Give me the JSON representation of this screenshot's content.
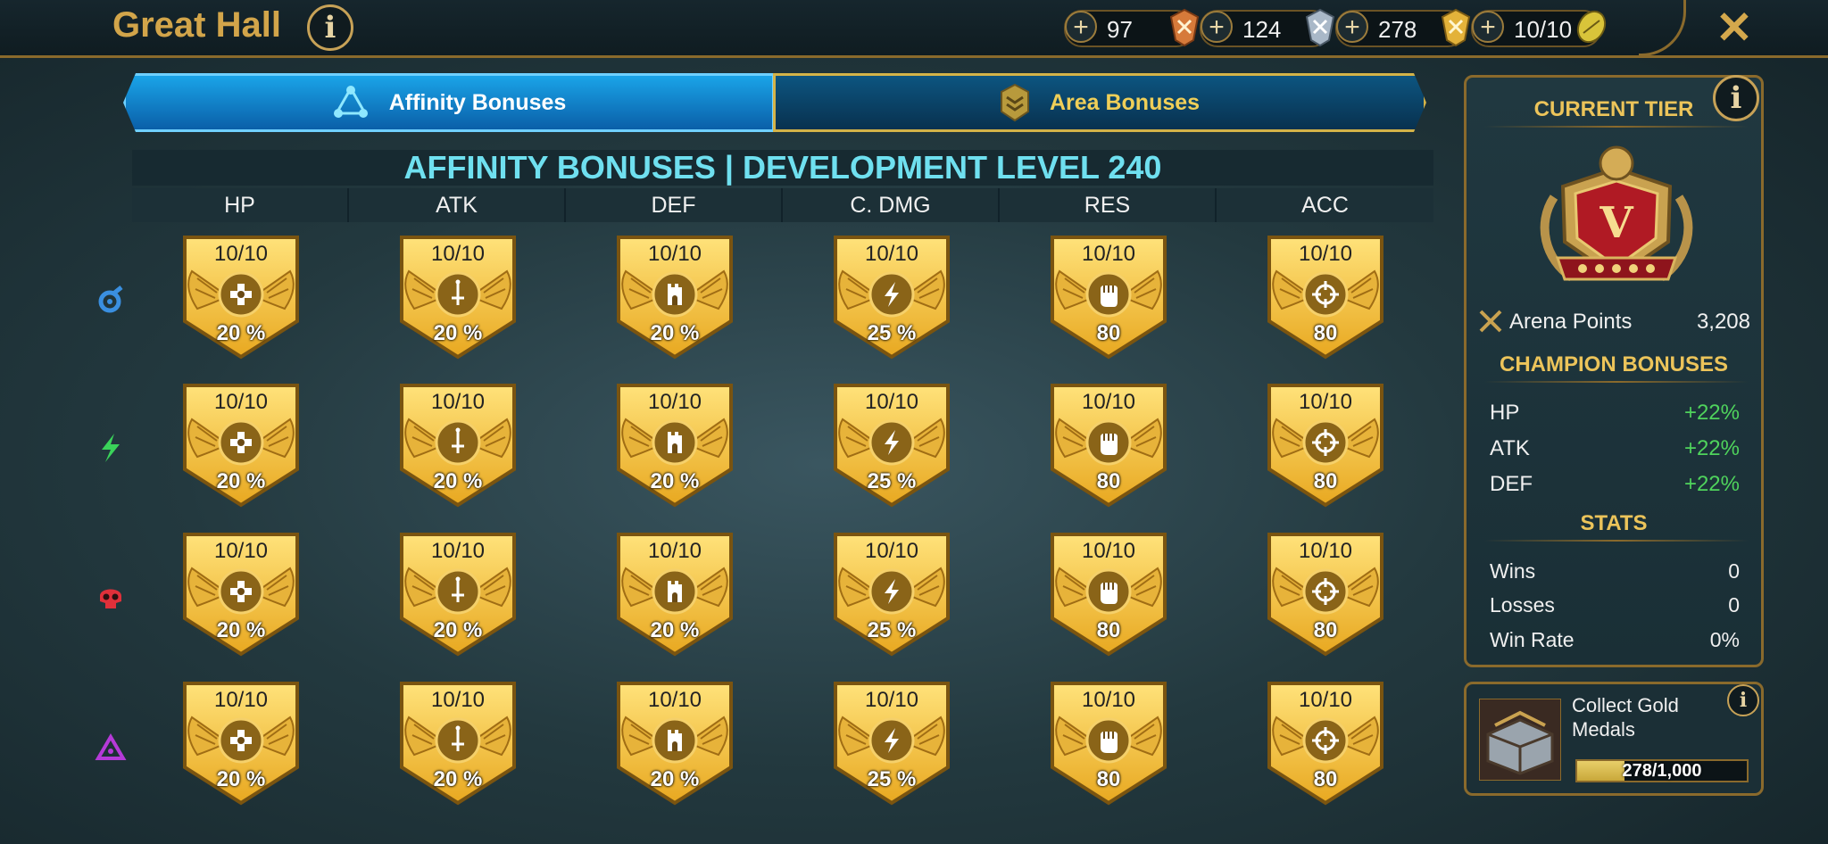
{
  "header": {
    "title": "Great Hall",
    "info_icon": "info-icon",
    "resources": [
      {
        "value": "97",
        "icon": "bronze-medal-icon",
        "color": "#d67a3a"
      },
      {
        "value": "124",
        "icon": "silver-medal-icon",
        "color": "#a9b8c8"
      },
      {
        "value": "278",
        "icon": "gold-medal-icon",
        "color": "#e3b23a"
      },
      {
        "value": "10/10",
        "icon": "arena-token-icon",
        "color": "#d9c43a"
      }
    ],
    "close_icon": "close-icon"
  },
  "tabs": [
    {
      "label": "Affinity Bonuses",
      "icon": "affinity-triangle-icon",
      "active": true
    },
    {
      "label": "Area Bonuses",
      "icon": "area-emblem-icon",
      "active": false
    }
  ],
  "grid": {
    "title": "AFFINITY BONUSES | DEVELOPMENT LEVEL 240",
    "columns": [
      "HP",
      "ATK",
      "DEF",
      "C. DMG",
      "RES",
      "ACC"
    ],
    "column_icons": [
      "cross-icon",
      "sword-icon",
      "tower-icon",
      "lightning-icon",
      "fist-icon",
      "crosshair-icon"
    ],
    "rows": [
      {
        "affinity": "magic",
        "icon": "magic-affinity-icon",
        "color": "#3a8fe0",
        "cells": [
          {
            "level": "10/10",
            "bonus": "20 %"
          },
          {
            "level": "10/10",
            "bonus": "20 %"
          },
          {
            "level": "10/10",
            "bonus": "20 %"
          },
          {
            "level": "10/10",
            "bonus": "25 %"
          },
          {
            "level": "10/10",
            "bonus": "80"
          },
          {
            "level": "10/10",
            "bonus": "80"
          }
        ]
      },
      {
        "affinity": "spirit",
        "icon": "spirit-affinity-icon",
        "color": "#3ad35a",
        "cells": [
          {
            "level": "10/10",
            "bonus": "20 %"
          },
          {
            "level": "10/10",
            "bonus": "20 %"
          },
          {
            "level": "10/10",
            "bonus": "20 %"
          },
          {
            "level": "10/10",
            "bonus": "25 %"
          },
          {
            "level": "10/10",
            "bonus": "80"
          },
          {
            "level": "10/10",
            "bonus": "80"
          }
        ]
      },
      {
        "affinity": "force",
        "icon": "force-affinity-icon",
        "color": "#e0303a",
        "cells": [
          {
            "level": "10/10",
            "bonus": "20 %"
          },
          {
            "level": "10/10",
            "bonus": "20 %"
          },
          {
            "level": "10/10",
            "bonus": "20 %"
          },
          {
            "level": "10/10",
            "bonus": "25 %"
          },
          {
            "level": "10/10",
            "bonus": "80"
          },
          {
            "level": "10/10",
            "bonus": "80"
          }
        ]
      },
      {
        "affinity": "void",
        "icon": "void-affinity-icon",
        "color": "#b53ad8",
        "cells": [
          {
            "level": "10/10",
            "bonus": "20 %"
          },
          {
            "level": "10/10",
            "bonus": "20 %"
          },
          {
            "level": "10/10",
            "bonus": "20 %"
          },
          {
            "level": "10/10",
            "bonus": "25 %"
          },
          {
            "level": "10/10",
            "bonus": "80"
          },
          {
            "level": "10/10",
            "bonus": "80"
          }
        ]
      }
    ]
  },
  "side": {
    "current_tier_label": "CURRENT TIER",
    "tier_emblem": "tier-v-emblem-icon",
    "tier_numeral": "V",
    "arena_points_label": "Arena Points",
    "arena_points_value": "3,208",
    "champion_bonuses_label": "CHAMPION BONUSES",
    "bonuses": [
      {
        "label": "HP",
        "value": "+22%"
      },
      {
        "label": "ATK",
        "value": "+22%"
      },
      {
        "label": "DEF",
        "value": "+22%"
      }
    ],
    "stats_label": "STATS",
    "stats": [
      {
        "label": "Wins",
        "value": "0"
      },
      {
        "label": "Losses",
        "value": "0"
      },
      {
        "label": "Win Rate",
        "value": "0%"
      }
    ]
  },
  "quest": {
    "title": "Collect Gold Medals",
    "progress_text": "278/1,000",
    "progress_fraction": 0.278,
    "icon": "chest-icon"
  }
}
